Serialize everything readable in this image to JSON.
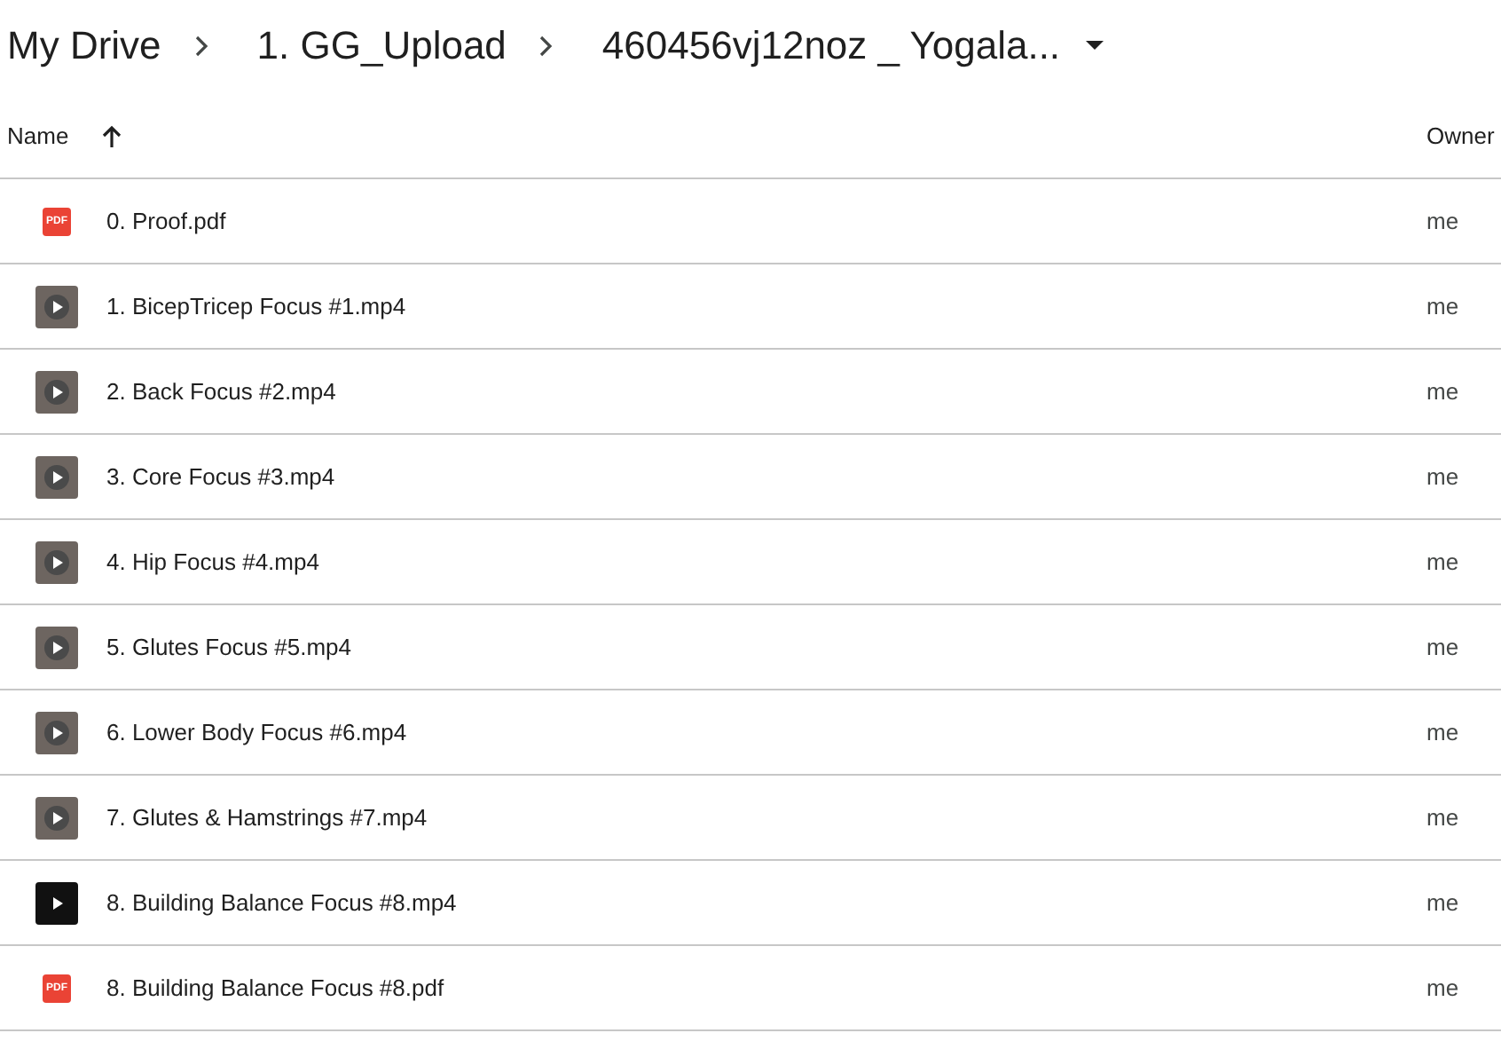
{
  "breadcrumbs": [
    {
      "label": "My Drive"
    },
    {
      "label": "1. GG_Upload"
    },
    {
      "label": "460456vj12noz _ Yogala..."
    }
  ],
  "columns": [
    {
      "label": "Name",
      "sorted": true
    },
    {
      "label": "Owner",
      "sorted": false
    }
  ],
  "rows": [
    {
      "kind": "pdf",
      "badge": "PDF",
      "name": "0. Proof.pdf",
      "owner": "me"
    },
    {
      "kind": "video",
      "dark": false,
      "name": "1. BicepTricep Focus #1.mp4",
      "owner": "me"
    },
    {
      "kind": "video",
      "dark": false,
      "name": "2. Back Focus #2.mp4",
      "owner": "me"
    },
    {
      "kind": "video",
      "dark": false,
      "name": "3. Core Focus #3.mp4",
      "owner": "me"
    },
    {
      "kind": "video",
      "dark": false,
      "name": "4. Hip Focus #4.mp4",
      "owner": "me"
    },
    {
      "kind": "video",
      "dark": false,
      "name": "5. Glutes Focus #5.mp4",
      "owner": "me"
    },
    {
      "kind": "video",
      "dark": false,
      "name": "6. Lower Body Focus #6.mp4",
      "owner": "me"
    },
    {
      "kind": "video",
      "dark": false,
      "name": "7. Glutes & Hamstrings #7.mp4",
      "owner": "me"
    },
    {
      "kind": "video",
      "dark": true,
      "name": "8. Building Balance Focus #8.mp4",
      "owner": "me"
    },
    {
      "kind": "pdf",
      "badge": "PDF",
      "name": "8. Building Balance Focus #8.pdf",
      "owner": "me"
    }
  ]
}
